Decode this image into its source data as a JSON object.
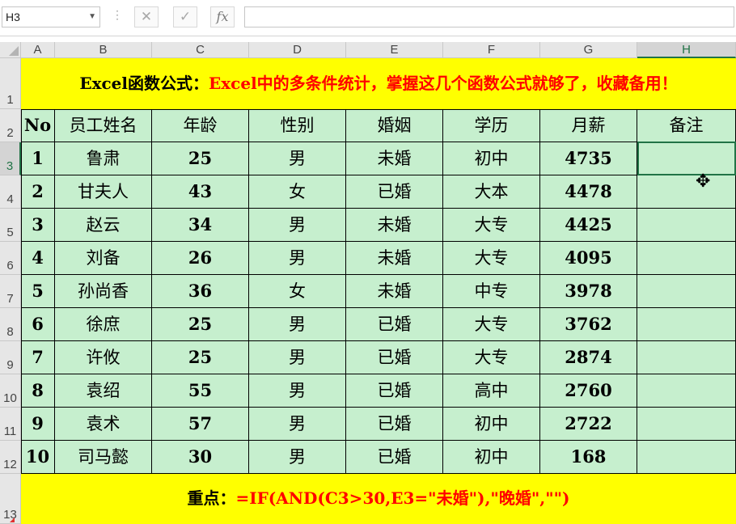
{
  "formula_bar": {
    "name_box": "H3",
    "cancel_icon": "✕",
    "enter_icon": "✓",
    "function_icon": "fx",
    "formula": ""
  },
  "columns": [
    "A",
    "B",
    "C",
    "D",
    "E",
    "F",
    "G",
    "H"
  ],
  "rows": [
    "1",
    "2",
    "3",
    "4",
    "5",
    "6",
    "7",
    "8",
    "9",
    "10",
    "11",
    "12",
    "13"
  ],
  "title": {
    "part1": "Excel函数公式：",
    "part2": "Excel中的多条件统计，掌握这几个函数公式就够了，收藏备用！"
  },
  "table": {
    "headers": [
      "No",
      "员工姓名",
      "年龄",
      "性别",
      "婚姻",
      "学历",
      "月薪",
      "备注"
    ],
    "rows": [
      [
        "1",
        "鲁肃",
        "25",
        "男",
        "未婚",
        "初中",
        "4735",
        ""
      ],
      [
        "2",
        "甘夫人",
        "43",
        "女",
        "已婚",
        "大本",
        "4478",
        ""
      ],
      [
        "3",
        "赵云",
        "34",
        "男",
        "未婚",
        "大专",
        "4425",
        ""
      ],
      [
        "4",
        "刘备",
        "26",
        "男",
        "未婚",
        "大专",
        "4095",
        ""
      ],
      [
        "5",
        "孙尚香",
        "36",
        "女",
        "未婚",
        "中专",
        "3978",
        ""
      ],
      [
        "6",
        "徐庶",
        "25",
        "男",
        "已婚",
        "大专",
        "3762",
        ""
      ],
      [
        "7",
        "许攸",
        "25",
        "男",
        "已婚",
        "大专",
        "2874",
        ""
      ],
      [
        "8",
        "袁绍",
        "55",
        "男",
        "已婚",
        "高中",
        "2760",
        ""
      ],
      [
        "9",
        "袁术",
        "57",
        "男",
        "已婚",
        "初中",
        "2722",
        ""
      ],
      [
        "10",
        "司马懿",
        "30",
        "男",
        "已婚",
        "初中",
        "168",
        ""
      ]
    ]
  },
  "note": {
    "label": "重点：",
    "formula": "=IF(AND(C3>30,E3=\"未婚\"),\"晚婚\",\"\")"
  },
  "selected_cell": "H3",
  "colors": {
    "header_bg": "#e6e6e6",
    "cell_bg": "#c6efce",
    "banner_bg": "#ffff00",
    "accent": "#217346",
    "red_text": "#ff0000"
  }
}
